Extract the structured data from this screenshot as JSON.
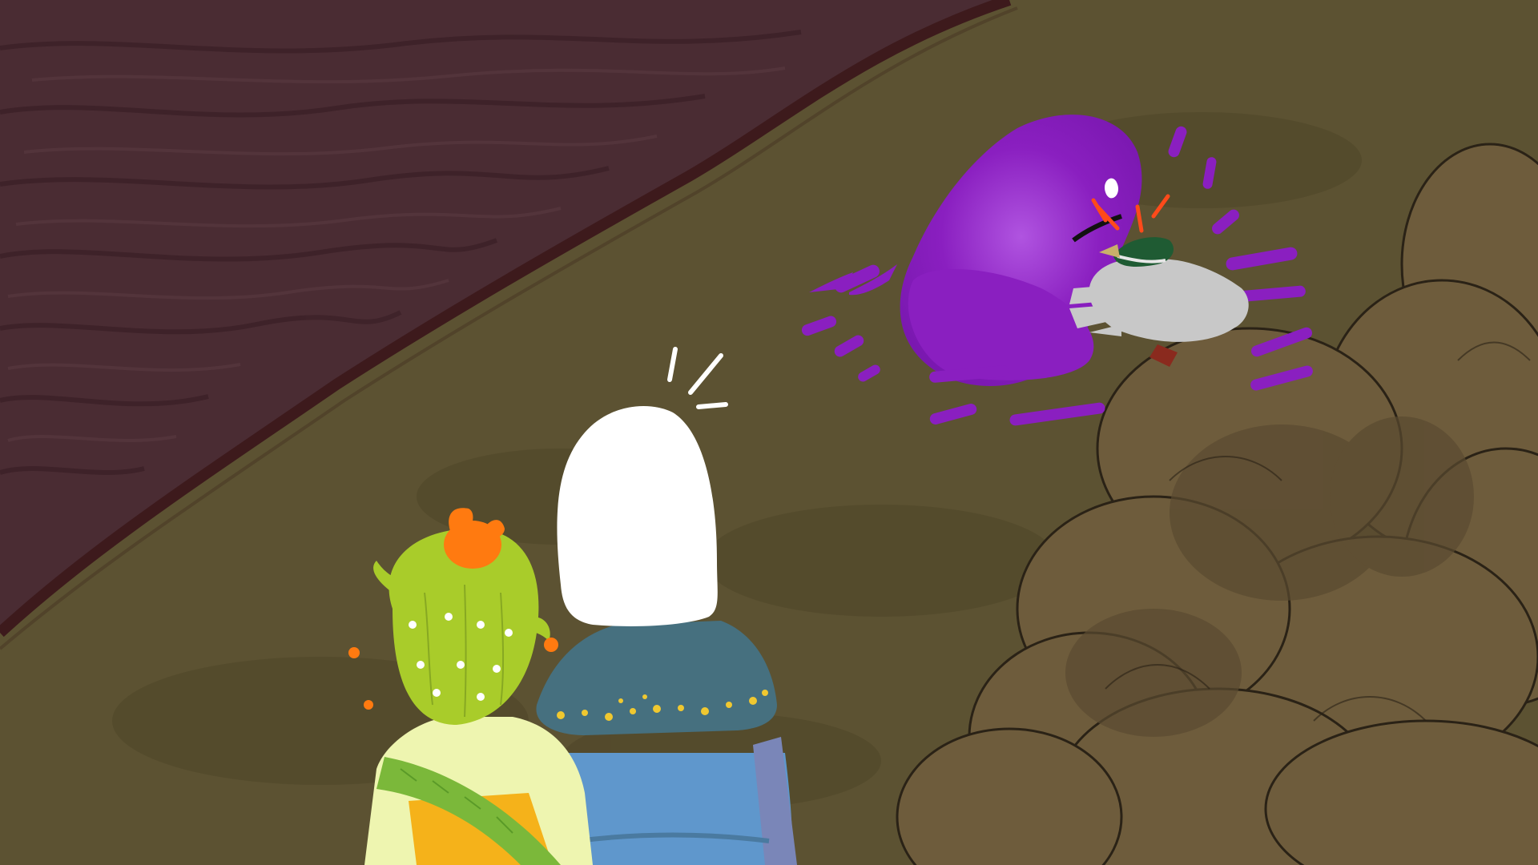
{
  "scene": {
    "colors": {
      "water": "#4a2c33",
      "water_streak": "#3a1f26",
      "water_highlight": "#5a3a41",
      "shore_edge": "#3d1a1c",
      "ground": "#5c5232",
      "ground_dark": "#4e4528",
      "smoke": "#6e5c3c",
      "smoke_dark": "#5a4a30",
      "smoke_outline": "#2a2216",
      "magic_purple": "#8a1fc0",
      "magic_purple_light": "#a24ad4",
      "bird_body": "#c8c8c8",
      "bird_head": "#1f5b33",
      "bird_beak": "#c9b06a",
      "alert_red": "#ff4a1a",
      "ghost_white": "#ffffff",
      "robe_collar": "#46707f",
      "robe_body": "#5f97cc",
      "robe_side": "#7a86b8",
      "star_yellow": "#f0c830",
      "cactus_green": "#a9cc2a",
      "cactus_flower": "#ff7a10",
      "shirt_pale": "#eef5b0",
      "shirt_orange": "#f5b21a",
      "sash_green": "#7bb83a"
    },
    "characters": [
      {
        "role": "cactus-kid"
      },
      {
        "role": "white-haired-figure"
      },
      {
        "role": "mallard-bird"
      }
    ]
  }
}
